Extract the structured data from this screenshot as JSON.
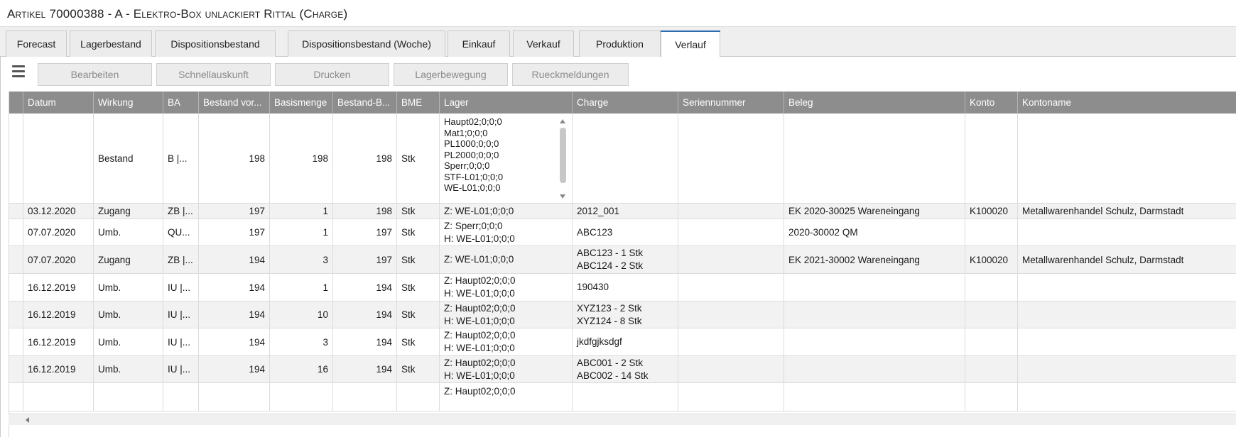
{
  "window": {
    "title": "Artikel 70000388 - A - Elektro-Box unlackiert Rittal (Charge)"
  },
  "tabs": [
    {
      "label": "Forecast",
      "active": false
    },
    {
      "label": "Lagerbestand",
      "active": false
    },
    {
      "label": "Dispositionsbestand",
      "active": false
    },
    {
      "label": "Dispositionsbestand (Woche)",
      "active": false
    },
    {
      "label": "Einkauf",
      "active": false
    },
    {
      "label": "Verkauf",
      "active": false
    },
    {
      "label": "Produktion",
      "active": false
    },
    {
      "label": "Verlauf",
      "active": true
    }
  ],
  "toolbar": {
    "menu_icon": "hamburger-menu-icon",
    "buttons": [
      {
        "label": "Bearbeiten",
        "disabled": true
      },
      {
        "label": "Schnellauskunft",
        "disabled": true
      },
      {
        "label": "Drucken",
        "disabled": true
      },
      {
        "label": "Lagerbewegung",
        "disabled": true
      },
      {
        "label": "Rueckmeldungen",
        "disabled": true
      }
    ]
  },
  "table": {
    "columns": [
      "Datum",
      "Wirkung",
      "BA",
      "Bestand vor...",
      "Basismenge",
      "Bestand-B...",
      "BME",
      "Lager",
      "Charge",
      "Seriennummer",
      "Beleg",
      "Konto",
      "Kontoname"
    ],
    "first_row": {
      "wirkung": "Bestand",
      "ba": "B |...",
      "bestand_vor": "198",
      "basismenge": "198",
      "bestand_b": "198",
      "bme": "Stk",
      "lager": [
        "Haupt02;0;0;0",
        "Mat1;0;0;0",
        "PL1000;0;0;0",
        "PL2000;0;0;0",
        "Sperr;0;0;0",
        "STF-L01;0;0;0",
        "WE-L01;0;0;0"
      ]
    },
    "rows": [
      {
        "datum": "03.12.2020",
        "wirkung": "Zugang",
        "ba": "ZB |...",
        "bestand_vor": "197",
        "basismenge": "1",
        "bestand_b": "198",
        "bme": "Stk",
        "lager1": "Z: WE-L01;0;0;0",
        "lager2": "",
        "charge1": "2012_001",
        "charge2": "",
        "seriennummer": "",
        "beleg": "EK  2020-30025  Wareneingang",
        "konto": "K100020",
        "kontoname": "Metallwarenhandel Schulz, Darmstadt"
      },
      {
        "datum": "07.07.2020",
        "wirkung": "Umb.",
        "ba": "QU...",
        "bestand_vor": "197",
        "basismenge": "1",
        "bestand_b": "197",
        "bme": "Stk",
        "lager1": "Z: Sperr;0;0;0",
        "lager2": "H: WE-L01;0;0;0",
        "charge1": "ABC123",
        "charge2": "",
        "seriennummer": "",
        "beleg": "2020-30002 QM",
        "konto": "",
        "kontoname": ""
      },
      {
        "datum": "07.07.2020",
        "wirkung": "Zugang",
        "ba": "ZB |...",
        "bestand_vor": "194",
        "basismenge": "3",
        "bestand_b": "197",
        "bme": "Stk",
        "lager1": "Z: WE-L01;0;0;0",
        "lager2": "",
        "charge1": "ABC123 - 1 Stk",
        "charge2": "ABC124 - 2 Stk",
        "seriennummer": "",
        "beleg": "EK  2021-30002  Wareneingang",
        "konto": "K100020",
        "kontoname": "Metallwarenhandel Schulz, Darmstadt"
      },
      {
        "datum": "16.12.2019",
        "wirkung": "Umb.",
        "ba": "IU |...",
        "bestand_vor": "194",
        "basismenge": "1",
        "bestand_b": "194",
        "bme": "Stk",
        "lager1": "Z: Haupt02;0;0;0",
        "lager2": "H: WE-L01;0;0;0",
        "charge1": "190430",
        "charge2": "",
        "seriennummer": "",
        "beleg": "",
        "konto": "",
        "kontoname": ""
      },
      {
        "datum": "16.12.2019",
        "wirkung": "Umb.",
        "ba": "IU |...",
        "bestand_vor": "194",
        "basismenge": "10",
        "bestand_b": "194",
        "bme": "Stk",
        "lager1": "Z: Haupt02;0;0;0",
        "lager2": "H: WE-L01;0;0;0",
        "charge1": "XYZ123 - 2 Stk",
        "charge2": "XYZ124 - 8 Stk",
        "seriennummer": "",
        "beleg": "",
        "konto": "",
        "kontoname": ""
      },
      {
        "datum": "16.12.2019",
        "wirkung": "Umb.",
        "ba": "IU |...",
        "bestand_vor": "194",
        "basismenge": "3",
        "bestand_b": "194",
        "bme": "Stk",
        "lager1": "Z: Haupt02;0;0;0",
        "lager2": "H: WE-L01;0;0;0",
        "charge1": "jkdfgjksdgf",
        "charge2": "",
        "seriennummer": "",
        "beleg": "",
        "konto": "",
        "kontoname": ""
      },
      {
        "datum": "16.12.2019",
        "wirkung": "Umb.",
        "ba": "IU |...",
        "bestand_vor": "194",
        "basismenge": "16",
        "bestand_b": "194",
        "bme": "Stk",
        "lager1": "Z: Haupt02;0;0;0",
        "lager2": "H: WE-L01;0;0;0",
        "charge1": "ABC001 - 2 Stk",
        "charge2": "ABC002 - 14 Stk",
        "seriennummer": "",
        "beleg": "",
        "konto": "",
        "kontoname": ""
      },
      {
        "datum": "",
        "wirkung": "",
        "ba": "",
        "bestand_vor": "",
        "basismenge": "",
        "bestand_b": "",
        "bme": "",
        "lager1": "Z: Haupt02;0;0;0",
        "lager2": "",
        "charge1": "",
        "charge2": "",
        "seriennummer": "",
        "beleg": "",
        "konto": "",
        "kontoname": ""
      }
    ]
  },
  "colors": {
    "header_bg": "#8d8d8d",
    "active_tab_accent": "#2b6cb0",
    "row_alt": "#f2f2f2"
  }
}
